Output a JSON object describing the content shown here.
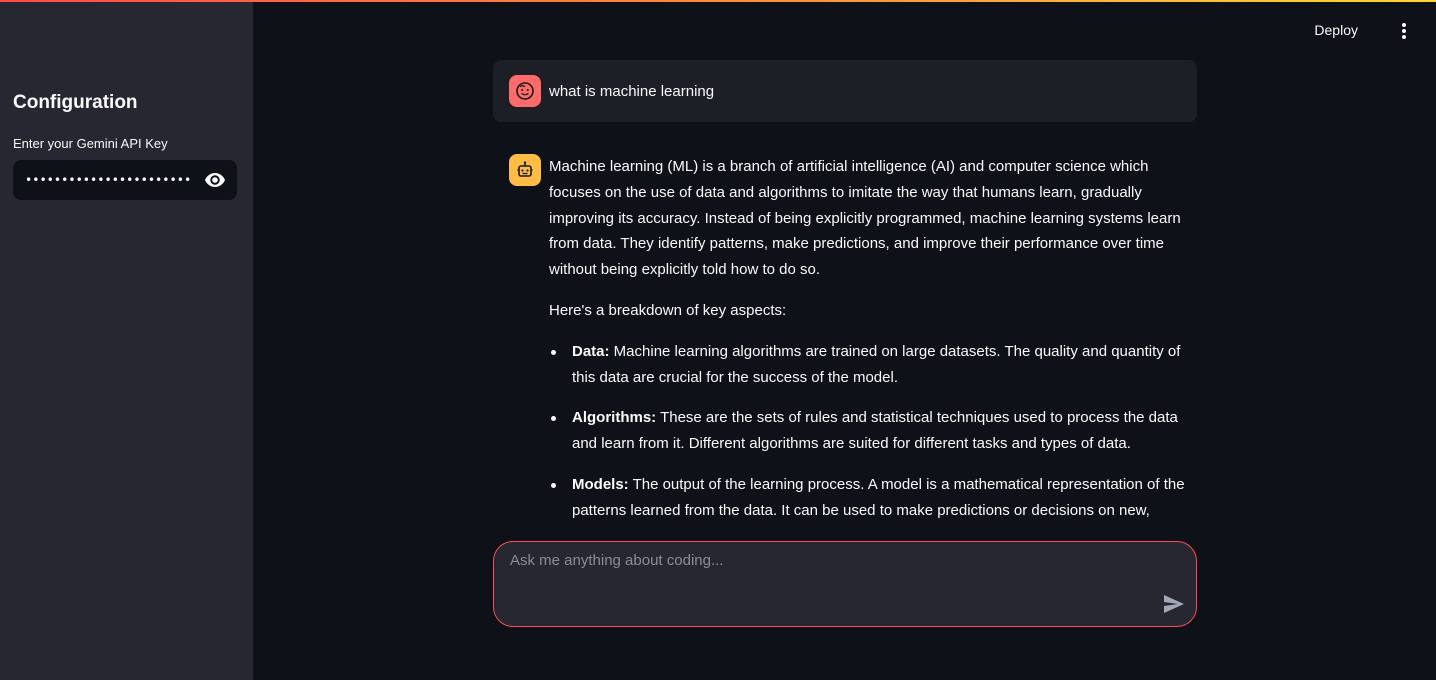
{
  "sidebar": {
    "title": "Configuration",
    "api_key_label": "Enter your Gemini API Key",
    "api_key_value": "•••••••••••••••••••••••••••••••••••••••"
  },
  "header": {
    "deploy_label": "Deploy"
  },
  "chat": {
    "user_message": "what is machine learning",
    "assistant": {
      "intro": "Machine learning (ML) is a branch of artificial intelligence (AI) and computer science which focuses on the use of data and algorithms to imitate the way that humans learn, gradually improving its accuracy. Instead of being explicitly programmed, machine learning systems learn from data. They identify patterns, make predictions, and improve their performance over time without being explicitly told how to do so.",
      "breakdown_heading": "Here's a breakdown of key aspects:",
      "points": [
        {
          "term": "Data:",
          "text": " Machine learning algorithms are trained on large datasets. The quality and quantity of this data are crucial for the success of the model."
        },
        {
          "term": "Algorithms:",
          "text": " These are the sets of rules and statistical techniques used to process the data and learn from it. Different algorithms are suited for different tasks and types of data."
        },
        {
          "term": "Models:",
          "text": " The output of the learning process. A model is a mathematical representation of the patterns learned from the data. It can be used to make predictions or decisions on new,"
        }
      ]
    },
    "input_placeholder": "Ask me anything about coding..."
  },
  "colors": {
    "accent": "#ff4b4b",
    "user_avatar": "#ff6b6b",
    "bot_avatar": "#ffbd45",
    "background": "#0e1117",
    "sidebar": "#262730"
  },
  "icons": {
    "password_toggle": "eye-icon",
    "menu": "kebab-menu-icon",
    "user_avatar": "user-face-icon",
    "bot_avatar": "robot-icon",
    "send": "send-icon"
  }
}
